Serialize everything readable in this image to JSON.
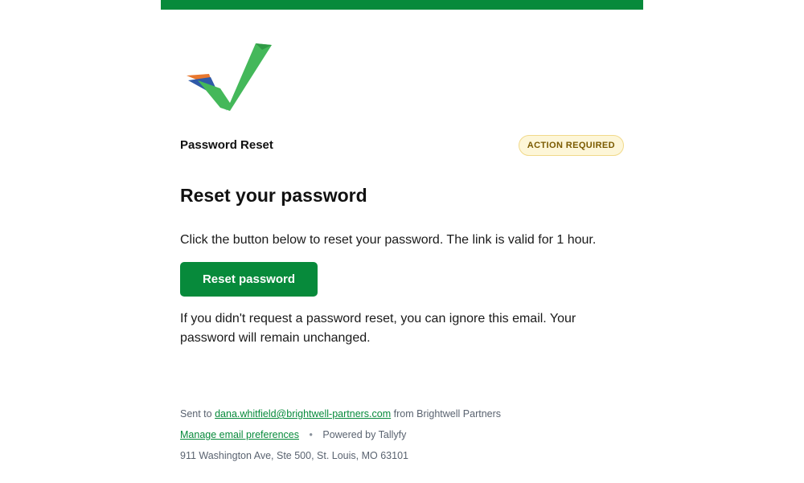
{
  "brand": {
    "accent_color": "#078a3b",
    "logo_icon": "checkmark-logo-icon"
  },
  "header": {
    "title": "Password Reset",
    "badge": "ACTION REQUIRED"
  },
  "main": {
    "heading": "Reset your password",
    "instructions": "Click the button below to reset your password. The link is valid for 1 hour.",
    "button_label": "Reset password",
    "disclaimer": "If you didn't request a password reset, you can ignore this email. Your password will remain unchanged."
  },
  "footer": {
    "sent_to_prefix": "Sent to",
    "email": "dana.whitfield@brightwell-partners.com",
    "from_text": "from Brightwell Partners",
    "manage_link": "Manage email preferences",
    "separator": "•",
    "powered_by": "Powered by Tallyfy",
    "address": "911 Washington Ave, Ste 500, St. Louis, MO 63101"
  }
}
